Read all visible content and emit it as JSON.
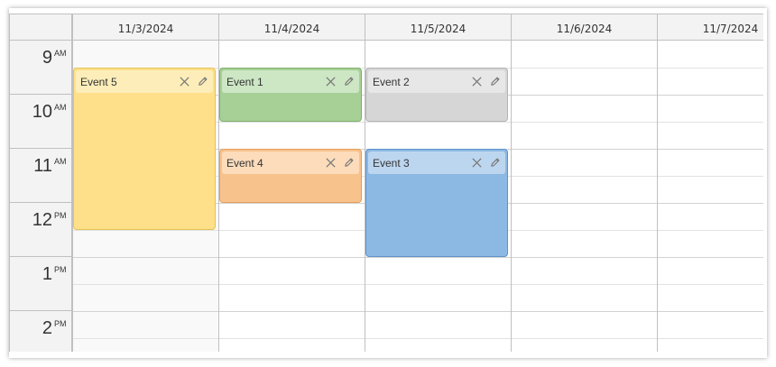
{
  "days": [
    "11/3/2024",
    "11/4/2024",
    "11/5/2024",
    "11/6/2024",
    "11/7/2024"
  ],
  "hours": [
    {
      "hour": "9",
      "ampm": "AM"
    },
    {
      "hour": "10",
      "ampm": "AM"
    },
    {
      "hour": "11",
      "ampm": "AM"
    },
    {
      "hour": "12",
      "ampm": "PM"
    },
    {
      "hour": "1",
      "ampm": "PM"
    },
    {
      "hour": "2",
      "ampm": "PM"
    }
  ],
  "events": [
    {
      "label": "Event 5",
      "day": "11/3/2024",
      "start": "9:30 AM",
      "end": "12:30 PM",
      "color": "#ffe08a",
      "bar_color": "#fdeeb9",
      "border": "#e6c155"
    },
    {
      "label": "Event 1",
      "day": "11/4/2024",
      "start": "9:30 AM",
      "end": "10:30 AM",
      "color": "#a7d096",
      "bar_color": "#cde7c4",
      "border": "#7fb06a"
    },
    {
      "label": "Event 4",
      "day": "11/4/2024",
      "start": "11:00 AM",
      "end": "12:00 PM",
      "color": "#f8c28c",
      "bar_color": "#fcdcbb",
      "border": "#e49e5a"
    },
    {
      "label": "Event 2",
      "day": "11/5/2024",
      "start": "9:30 AM",
      "end": "10:30 AM",
      "color": "#d6d6d6",
      "bar_color": "#e7e7e7",
      "border": "#b3b3b3"
    },
    {
      "label": "Event 3",
      "day": "11/5/2024",
      "start": "11:00 AM",
      "end": "1:00 PM",
      "color": "#8cb8e4",
      "bar_color": "#bdd6ef",
      "border": "#5f93c9"
    }
  ]
}
